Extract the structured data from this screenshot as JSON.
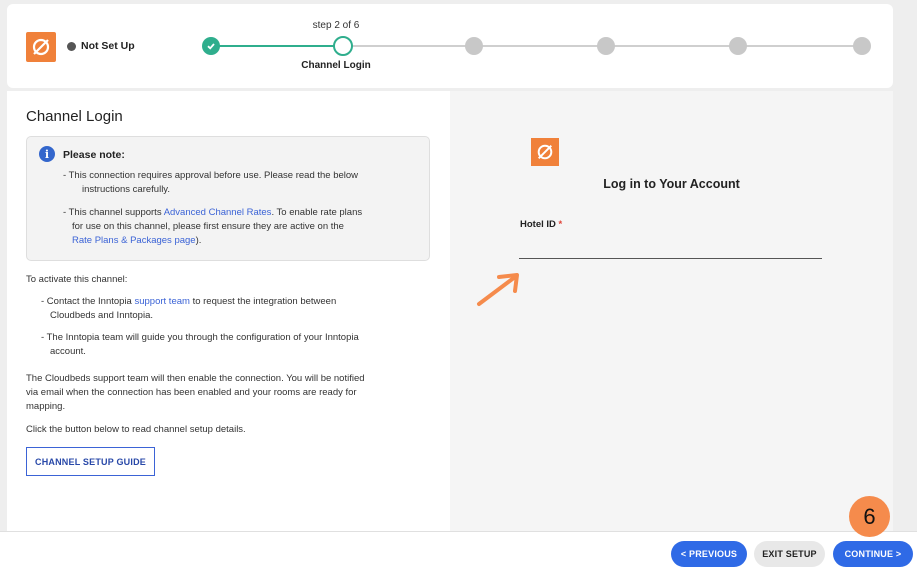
{
  "header": {
    "status_label": "Not Set Up",
    "step_counter": "step 2 of 6",
    "current_step_name": "Channel Login",
    "steps_total": 6,
    "current_step": 2
  },
  "left": {
    "title": "Channel Login",
    "note": {
      "title": "Please note:",
      "line1": "- This connection requires approval before use. Please read the below",
      "line1b": "instructions carefully.",
      "line2a": "- This channel supports ",
      "line2_link": "Advanced Channel Rates",
      "line2b": ". To enable rate plans",
      "line2c": "for use on this channel, please first ensure they are active on the",
      "line2_link2": "Rate Plans & Packages page",
      "line2d": ")."
    },
    "activate_intro": "To activate this channel:",
    "bullet1a": "- Contact the Inntopia ",
    "bullet1_link": "support team",
    "bullet1b": " to request the integration between",
    "bullet1c": "Cloudbeds and Inntopia.",
    "bullet2a": "- The Inntopia team will guide you through the configuration of your Inntopia",
    "bullet2b": "account.",
    "support_para1": "The Cloudbeds support team will then enable the connection. You will be notified",
    "support_para2": "via email when the connection has been enabled and your rooms are ready for",
    "support_para3": "mapping.",
    "click_text": "Click the button below to read channel setup details.",
    "guide_button": "CHANNEL SETUP GUIDE"
  },
  "right": {
    "heading": "Log in to Your Account",
    "hotel_id_label": "Hotel ID",
    "required_mark": "*",
    "hotel_id_value": ""
  },
  "footer": {
    "previous": "< PREVIOUS",
    "exit": "EXIT SETUP",
    "continue": "CONTINUE >"
  },
  "annotation_badge": "6",
  "colors": {
    "brand_orange": "#f0813a",
    "progress_green": "#2fae8d",
    "primary_blue": "#2f6ae6",
    "link_blue": "#3b63d6"
  }
}
